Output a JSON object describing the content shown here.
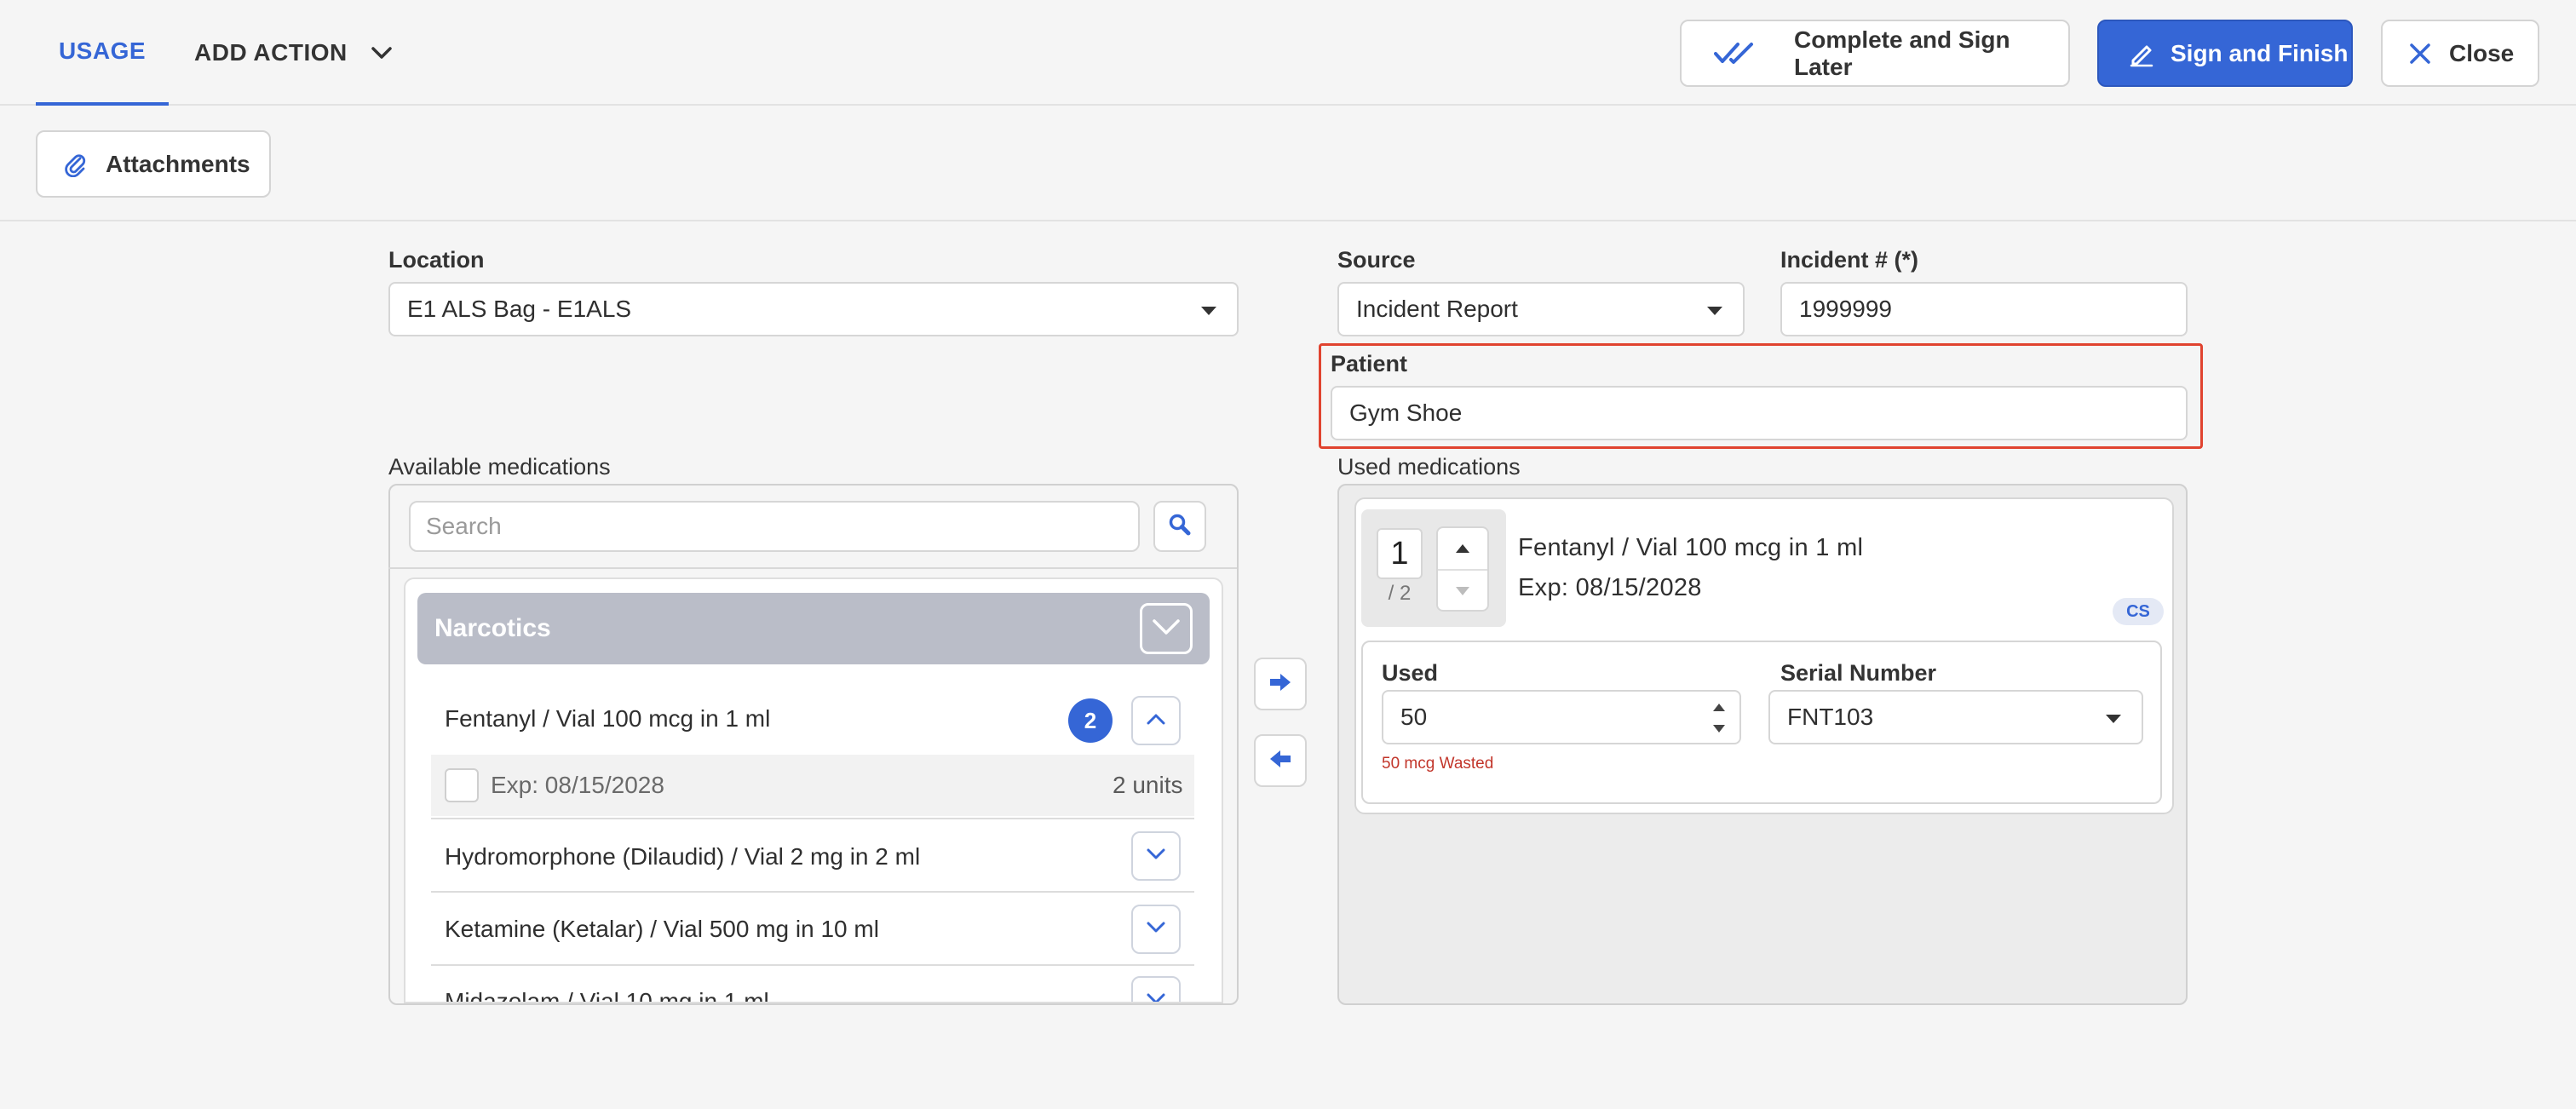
{
  "header": {
    "tabs": [
      {
        "label": "USAGE",
        "active": true
      },
      {
        "label": "ADD ACTION",
        "active": false
      }
    ],
    "buttons": {
      "complete_later": "Complete and Sign Later",
      "sign_finish": "Sign and Finish",
      "close": "Close"
    }
  },
  "toolbar": {
    "attachments": "Attachments"
  },
  "form": {
    "location": {
      "label": "Location",
      "value": "E1 ALS Bag - E1ALS"
    },
    "source": {
      "label": "Source",
      "value": "Incident Report"
    },
    "incident": {
      "label": "Incident # (*)",
      "value": "1999999"
    },
    "patient": {
      "label": "Patient",
      "value": "Gym Shoe"
    }
  },
  "available": {
    "label": "Available medications",
    "search_placeholder": "Search",
    "category": "Narcotics",
    "items": [
      {
        "name": "Fentanyl / Vial 100 mcg in 1 ml",
        "count": "2",
        "expanded": true,
        "lots": [
          {
            "exp": "Exp: 08/15/2028",
            "units": "2 units"
          }
        ]
      },
      {
        "name": "Hydromorphone (Dilaudid) / Vial 2 mg in 2 ml",
        "expanded": false
      },
      {
        "name": "Ketamine (Ketalar) / Vial 500 mg in 10 ml",
        "expanded": false
      },
      {
        "name": "Midazolam / Vial 10 mg in 1 ml",
        "expanded": false
      }
    ]
  },
  "used": {
    "label": "Used medications",
    "items": [
      {
        "qty": "1",
        "of": "/ 2",
        "name": "Fentanyl / Vial 100 mcg in 1 ml",
        "exp": "Exp: 08/15/2028",
        "badge": "CS",
        "used_label": "Used",
        "used_value": "50",
        "serial_label": "Serial Number",
        "serial_value": "FNT103",
        "wasted": "50 mcg Wasted"
      }
    ]
  },
  "colors": {
    "accent": "#3566d6",
    "highlight": "#e0432f",
    "category": "#babdc8",
    "warning": "#c2362b"
  },
  "icons": {
    "complete_later": "double-check-icon",
    "sign_finish": "pen-icon",
    "close": "close-icon",
    "attachments": "paperclip-icon",
    "search": "search-icon",
    "move_right": "arrow-right-icon",
    "move_left": "arrow-left-icon"
  }
}
